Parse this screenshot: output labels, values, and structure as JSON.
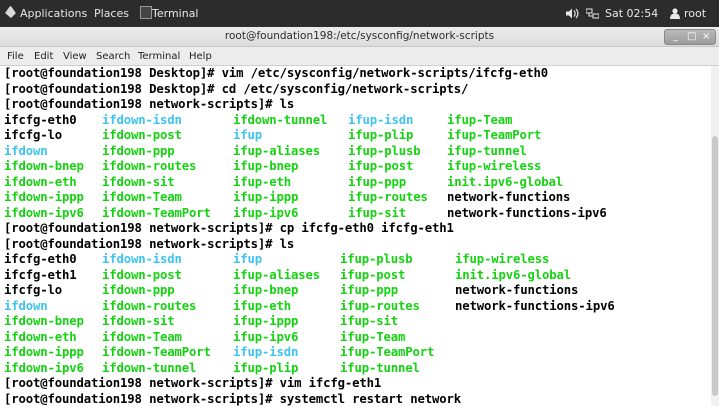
{
  "topbar": {
    "applications": "Applications",
    "places": "Places",
    "terminal": "Terminal",
    "time": "Sat 02:54",
    "user": "root"
  },
  "window": {
    "title": "root@foundation198:/etc/sysconfig/network-scripts",
    "minimize": "_",
    "maximize": "□",
    "close": "×"
  },
  "menu": [
    "File",
    "Edit",
    "View",
    "Search",
    "Terminal",
    "Help"
  ],
  "colors": {
    "exec_green": "#16d312",
    "link_cyan": "#3fc4f0"
  },
  "terminal": {
    "commands": [
      "[root@foundation198 Desktop]# vim /etc/sysconfig/network-scripts/ifcfg-eth0",
      "[root@foundation198 Desktop]# cd /etc/sysconfig/network-scripts/",
      "[root@foundation198 network-scripts]# ls",
      "[root@foundation198 network-scripts]# cp ifcfg-eth0 ifcfg-eth1",
      "[root@foundation198 network-scripts]# ls",
      "[root@foundation198 network-scripts]# vim ifcfg-eth1",
      "[root@foundation198 network-scripts]# systemctl restart network"
    ],
    "ls1": [
      [
        "ifcfg-eth0",
        "ifdown-isdn",
        "ifdown-tunnel",
        "ifup-isdn",
        "ifup-Team"
      ],
      [
        "ifcfg-lo",
        "ifdown-post",
        "ifup",
        "ifup-plip",
        "ifup-TeamPort"
      ],
      [
        "ifdown",
        "ifdown-ppp",
        "ifup-aliases",
        "ifup-plusb",
        "ifup-tunnel"
      ],
      [
        "ifdown-bnep",
        "ifdown-routes",
        "ifup-bnep",
        "ifup-post",
        "ifup-wireless"
      ],
      [
        "ifdown-eth",
        "ifdown-sit",
        "ifup-eth",
        "ifup-ppp",
        "init.ipv6-global"
      ],
      [
        "ifdown-ippp",
        "ifdown-Team",
        "ifup-ippp",
        "ifup-routes",
        "network-functions"
      ],
      [
        "ifdown-ipv6",
        "ifdown-TeamPort",
        "ifup-ipv6",
        "ifup-sit",
        "network-functions-ipv6"
      ]
    ],
    "ls2": [
      [
        "ifcfg-eth0",
        "ifdown-isdn",
        "ifup",
        "ifup-plusb",
        "ifup-wireless"
      ],
      [
        "ifcfg-eth1",
        "ifdown-post",
        "ifup-aliases",
        "ifup-post",
        "init.ipv6-global"
      ],
      [
        "ifcfg-lo",
        "ifdown-ppp",
        "ifup-bnep",
        "ifup-ppp",
        "network-functions"
      ],
      [
        "ifdown",
        "ifdown-routes",
        "ifup-eth",
        "ifup-routes",
        "network-functions-ipv6"
      ],
      [
        "ifdown-bnep",
        "ifdown-sit",
        "ifup-ippp",
        "ifup-sit",
        ""
      ],
      [
        "ifdown-eth",
        "ifdown-Team",
        "ifup-ipv6",
        "ifup-Team",
        ""
      ],
      [
        "ifdown-ippp",
        "ifdown-TeamPort",
        "ifup-isdn",
        "ifup-TeamPort",
        ""
      ],
      [
        "ifdown-ipv6",
        "ifdown-tunnel",
        "ifup-plip",
        "ifup-tunnel",
        ""
      ]
    ]
  }
}
